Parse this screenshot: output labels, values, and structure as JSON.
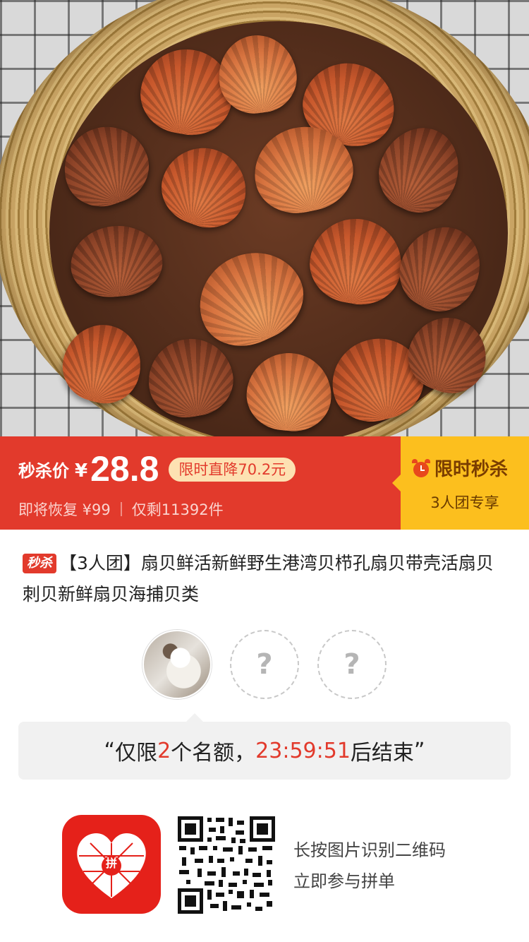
{
  "banner": {
    "price_label": "秒杀价",
    "currency": "¥",
    "price": "28.8",
    "discount": "限时直降70.2元",
    "restore_text": "即将恢复 ¥99",
    "stock_text": "仅剩11392件",
    "flash_title": "限时秒杀",
    "flash_sub": "3人团专享",
    "colors": {
      "red": "#e23a2c",
      "yellow": "#fcbf1e"
    }
  },
  "product": {
    "badge": "秒杀",
    "title": "【3人团】扇贝鲜活新鲜野生港湾贝栉孔扇贝带壳活扇贝刺贝新鲜扇贝海捕贝类"
  },
  "group": {
    "empty_slot_symbol": "?"
  },
  "quota": {
    "open_quote": "“",
    "prefix": "仅限",
    "count": "2",
    "mid": "个名额，",
    "countdown": "23:59:51",
    "suffix": "后结束",
    "close_quote": "”"
  },
  "footer": {
    "logo_text": "拼",
    "hint_line1": "长按图片识别二维码",
    "hint_line2": "立即参与拼单"
  }
}
